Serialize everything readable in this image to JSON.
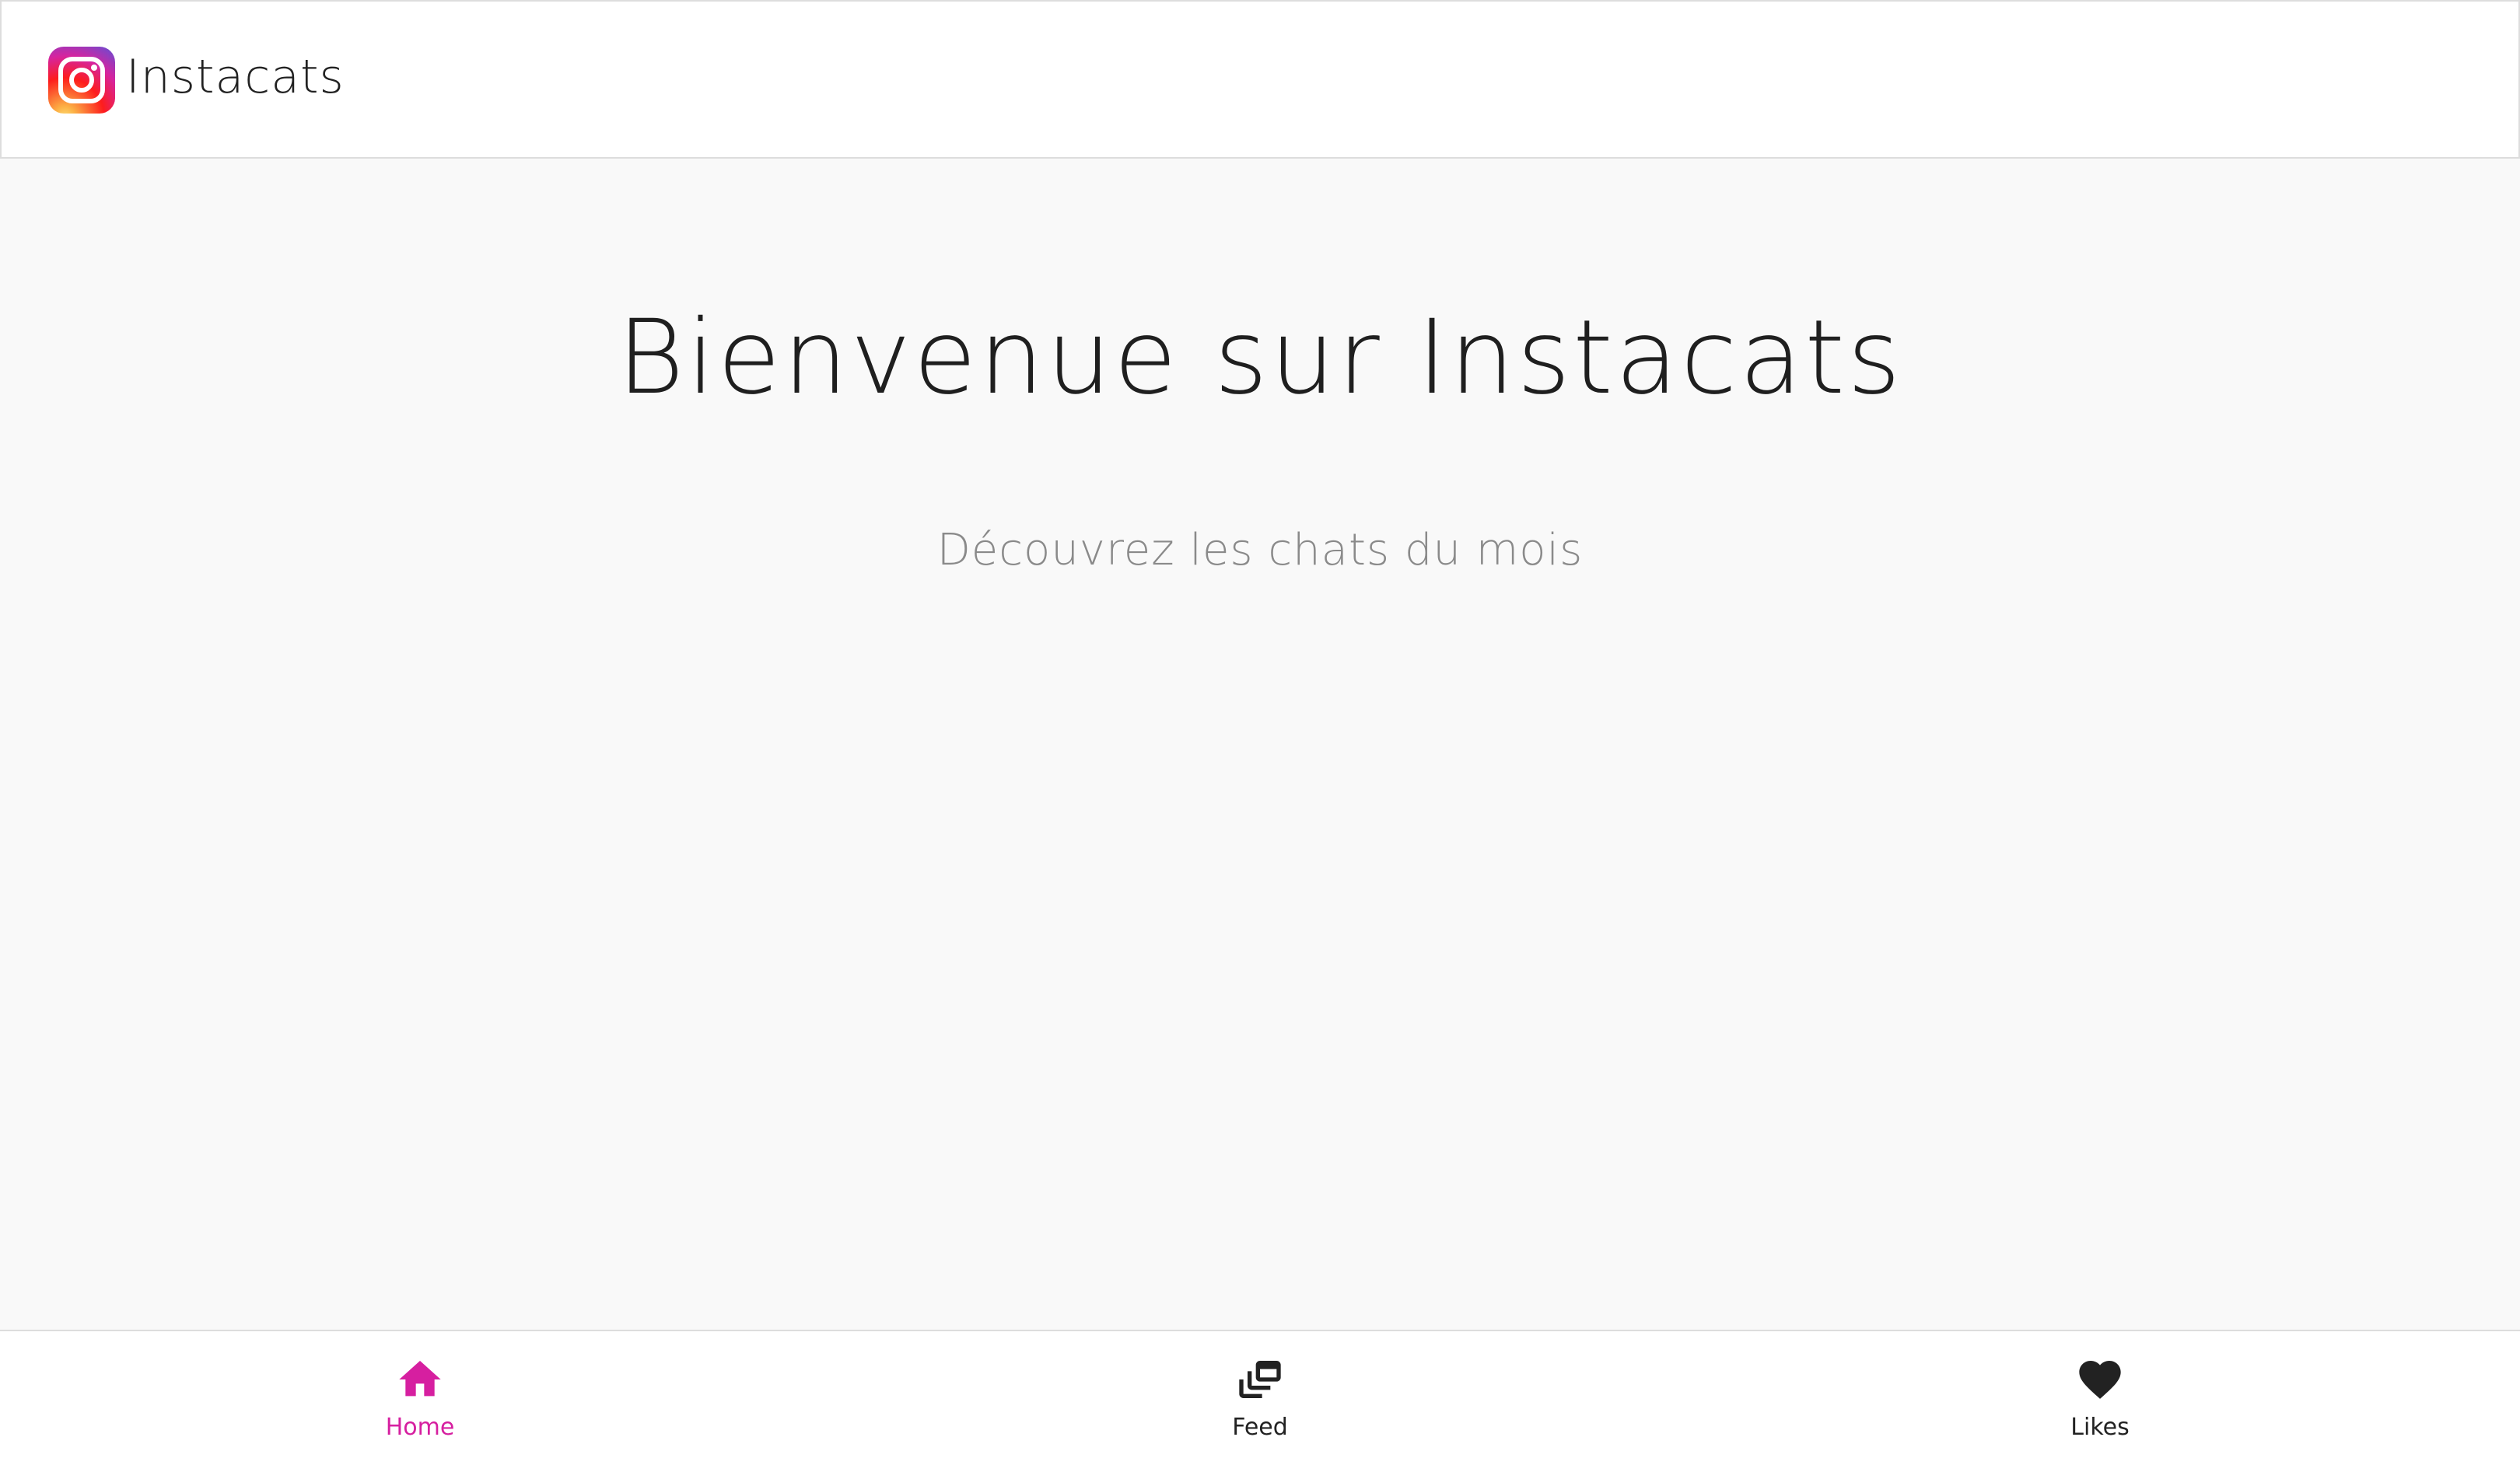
{
  "header": {
    "title": "Instacats",
    "logo_icon": "instagram-logo-icon"
  },
  "main": {
    "title": "Bienvenue sur Instacats",
    "subtitle": "Découvrez les chats du mois"
  },
  "bottom_nav": {
    "items": [
      {
        "label": "Home",
        "icon": "home-icon",
        "active": true
      },
      {
        "label": "Feed",
        "icon": "dynamic-feed-icon",
        "active": false
      },
      {
        "label": "Likes",
        "icon": "heart-icon",
        "active": false
      }
    ]
  },
  "colors": {
    "accent": "#d61fa0",
    "background": "#f9f9f9",
    "header_bg": "#ffffff",
    "text": "#222222",
    "subtitle": "#8a8a8a"
  }
}
